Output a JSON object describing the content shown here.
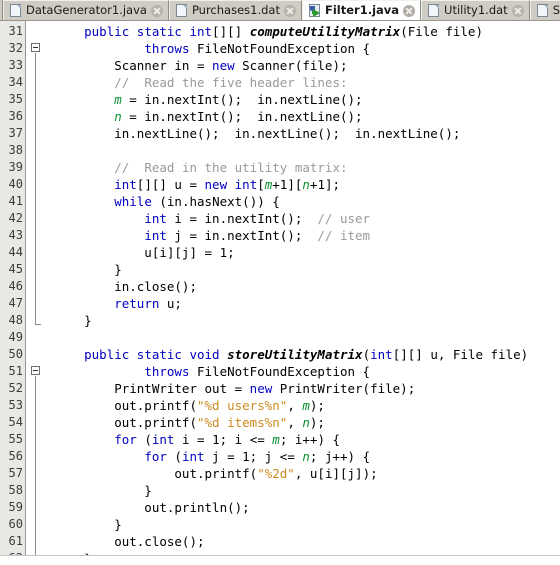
{
  "window": {
    "app": "NetBeans Java Editor",
    "title": "Filter1.java"
  },
  "tabs": [
    {
      "label": "DataGenerator1.java",
      "icon": "java-file-icon",
      "active": false,
      "close": "close-icon"
    },
    {
      "label": "Purchases1.dat",
      "icon": "dat-file-icon",
      "active": false,
      "close": "close-icon"
    },
    {
      "label": "Filter1.java",
      "icon": "java-run-file-icon",
      "active": true,
      "close": "close-icon"
    },
    {
      "label": "Utility1.dat",
      "icon": "dat-file-icon",
      "active": false,
      "close": "close-icon"
    },
    {
      "label": "Similarity",
      "icon": "dat-file-icon",
      "active": false,
      "close": "close-icon"
    }
  ],
  "editor": {
    "first_line": 31,
    "last_line": 62,
    "line_numbers": [
      31,
      32,
      33,
      34,
      35,
      36,
      37,
      38,
      39,
      40,
      41,
      42,
      43,
      44,
      45,
      46,
      47,
      48,
      49,
      50,
      51,
      52,
      53,
      54,
      55,
      56,
      57,
      58,
      59,
      60,
      61,
      62
    ],
    "fold_markers": [
      {
        "line": 32,
        "type": "collapse-box"
      },
      {
        "line": 51,
        "type": "collapse-box"
      }
    ],
    "colors": {
      "keyword": "#0000c0",
      "method": "#000000",
      "comment": "#9a9a9a",
      "field": "#0a8f2e",
      "string": "#cc8b1f",
      "plain": "#000000",
      "gutter_bg": "#e8e8e4",
      "editor_bg": "#ffffff"
    },
    "lines": [
      {
        "n": 31,
        "tokens": [
          {
            "t": "    ",
            "c": "pln"
          },
          {
            "t": "public static int",
            "c": "kw"
          },
          {
            "t": "[][] ",
            "c": "pln"
          },
          {
            "t": "computeUtilityMatrix",
            "c": "mth"
          },
          {
            "t": "(File file)",
            "c": "pln"
          }
        ]
      },
      {
        "n": 32,
        "tokens": [
          {
            "t": "            ",
            "c": "pln"
          },
          {
            "t": "throws",
            "c": "kw"
          },
          {
            "t": " FileNotFoundException {",
            "c": "pln"
          }
        ]
      },
      {
        "n": 33,
        "tokens": [
          {
            "t": "        Scanner in = ",
            "c": "pln"
          },
          {
            "t": "new",
            "c": "kw"
          },
          {
            "t": " Scanner(file);",
            "c": "pln"
          }
        ]
      },
      {
        "n": 34,
        "tokens": [
          {
            "t": "        ",
            "c": "pln"
          },
          {
            "t": "//  Read the five header lines:",
            "c": "cmt"
          }
        ]
      },
      {
        "n": 35,
        "tokens": [
          {
            "t": "        ",
            "c": "pln"
          },
          {
            "t": "m",
            "c": "fld"
          },
          {
            "t": " = in.nextInt();  in.nextLine();",
            "c": "pln"
          }
        ]
      },
      {
        "n": 36,
        "tokens": [
          {
            "t": "        ",
            "c": "pln"
          },
          {
            "t": "n",
            "c": "fld"
          },
          {
            "t": " = in.nextInt();  in.nextLine();",
            "c": "pln"
          }
        ]
      },
      {
        "n": 37,
        "tokens": [
          {
            "t": "        in.nextLine();  in.nextLine();  in.nextLine();",
            "c": "pln"
          }
        ]
      },
      {
        "n": 38,
        "tokens": [
          {
            "t": "",
            "c": "pln"
          }
        ]
      },
      {
        "n": 39,
        "tokens": [
          {
            "t": "        ",
            "c": "pln"
          },
          {
            "t": "//  Read in the utility matrix:",
            "c": "cmt"
          }
        ]
      },
      {
        "n": 40,
        "tokens": [
          {
            "t": "        ",
            "c": "pln"
          },
          {
            "t": "int",
            "c": "kw"
          },
          {
            "t": "[][] u = ",
            "c": "pln"
          },
          {
            "t": "new",
            "c": "kw"
          },
          {
            "t": " ",
            "c": "pln"
          },
          {
            "t": "int",
            "c": "kw"
          },
          {
            "t": "[",
            "c": "pln"
          },
          {
            "t": "m",
            "c": "fld"
          },
          {
            "t": "+1][",
            "c": "pln"
          },
          {
            "t": "n",
            "c": "fld"
          },
          {
            "t": "+1];",
            "c": "pln"
          }
        ]
      },
      {
        "n": 41,
        "tokens": [
          {
            "t": "        ",
            "c": "pln"
          },
          {
            "t": "while",
            "c": "kw"
          },
          {
            "t": " (in.hasNext()) {",
            "c": "pln"
          }
        ]
      },
      {
        "n": 42,
        "tokens": [
          {
            "t": "            ",
            "c": "pln"
          },
          {
            "t": "int",
            "c": "kw"
          },
          {
            "t": " i = in.nextInt();  ",
            "c": "pln"
          },
          {
            "t": "// user",
            "c": "cmt"
          }
        ]
      },
      {
        "n": 43,
        "tokens": [
          {
            "t": "            ",
            "c": "pln"
          },
          {
            "t": "int",
            "c": "kw"
          },
          {
            "t": " j = in.nextInt();  ",
            "c": "pln"
          },
          {
            "t": "// item",
            "c": "cmt"
          }
        ]
      },
      {
        "n": 44,
        "tokens": [
          {
            "t": "            u[i][j] = 1;",
            "c": "pln"
          }
        ]
      },
      {
        "n": 45,
        "tokens": [
          {
            "t": "        }",
            "c": "pln"
          }
        ]
      },
      {
        "n": 46,
        "tokens": [
          {
            "t": "        in.close();",
            "c": "pln"
          }
        ]
      },
      {
        "n": 47,
        "tokens": [
          {
            "t": "        ",
            "c": "pln"
          },
          {
            "t": "return",
            "c": "kw"
          },
          {
            "t": " u;",
            "c": "pln"
          }
        ]
      },
      {
        "n": 48,
        "tokens": [
          {
            "t": "    }",
            "c": "pln"
          }
        ]
      },
      {
        "n": 49,
        "tokens": [
          {
            "t": "",
            "c": "pln"
          }
        ]
      },
      {
        "n": 50,
        "tokens": [
          {
            "t": "    ",
            "c": "pln"
          },
          {
            "t": "public static void",
            "c": "kw"
          },
          {
            "t": " ",
            "c": "pln"
          },
          {
            "t": "storeUtilityMatrix",
            "c": "mth"
          },
          {
            "t": "(",
            "c": "pln"
          },
          {
            "t": "int",
            "c": "kw"
          },
          {
            "t": "[][] u, File file)",
            "c": "pln"
          }
        ]
      },
      {
        "n": 51,
        "tokens": [
          {
            "t": "            ",
            "c": "pln"
          },
          {
            "t": "throws",
            "c": "kw"
          },
          {
            "t": " FileNotFoundException {",
            "c": "pln"
          }
        ]
      },
      {
        "n": 52,
        "tokens": [
          {
            "t": "        PrintWriter out = ",
            "c": "pln"
          },
          {
            "t": "new",
            "c": "kw"
          },
          {
            "t": " PrintWriter(file);",
            "c": "pln"
          }
        ]
      },
      {
        "n": 53,
        "tokens": [
          {
            "t": "        out.printf(",
            "c": "pln"
          },
          {
            "t": "\"%d users%n\"",
            "c": "str"
          },
          {
            "t": ", ",
            "c": "pln"
          },
          {
            "t": "m",
            "c": "fld"
          },
          {
            "t": ");",
            "c": "pln"
          }
        ]
      },
      {
        "n": 54,
        "tokens": [
          {
            "t": "        out.printf(",
            "c": "pln"
          },
          {
            "t": "\"%d items%n\"",
            "c": "str"
          },
          {
            "t": ", ",
            "c": "pln"
          },
          {
            "t": "n",
            "c": "fld"
          },
          {
            "t": ");",
            "c": "pln"
          }
        ]
      },
      {
        "n": 55,
        "tokens": [
          {
            "t": "        ",
            "c": "pln"
          },
          {
            "t": "for",
            "c": "kw"
          },
          {
            "t": " (",
            "c": "pln"
          },
          {
            "t": "int",
            "c": "kw"
          },
          {
            "t": " i = 1; i <= ",
            "c": "pln"
          },
          {
            "t": "m",
            "c": "fld"
          },
          {
            "t": "; i++) {",
            "c": "pln"
          }
        ]
      },
      {
        "n": 56,
        "tokens": [
          {
            "t": "            ",
            "c": "pln"
          },
          {
            "t": "for",
            "c": "kw"
          },
          {
            "t": " (",
            "c": "pln"
          },
          {
            "t": "int",
            "c": "kw"
          },
          {
            "t": " j = 1; j <= ",
            "c": "pln"
          },
          {
            "t": "n",
            "c": "fld"
          },
          {
            "t": "; j++) {",
            "c": "pln"
          }
        ]
      },
      {
        "n": 57,
        "tokens": [
          {
            "t": "                out.printf(",
            "c": "pln"
          },
          {
            "t": "\"%2d\"",
            "c": "str"
          },
          {
            "t": ", u[i][j]);",
            "c": "pln"
          }
        ]
      },
      {
        "n": 58,
        "tokens": [
          {
            "t": "            }",
            "c": "pln"
          }
        ]
      },
      {
        "n": 59,
        "tokens": [
          {
            "t": "            out.println();",
            "c": "pln"
          }
        ]
      },
      {
        "n": 60,
        "tokens": [
          {
            "t": "        }",
            "c": "pln"
          }
        ]
      },
      {
        "n": 61,
        "tokens": [
          {
            "t": "        out.close();",
            "c": "pln"
          }
        ]
      },
      {
        "n": 62,
        "tokens": [
          {
            "t": "    }",
            "c": "pln"
          }
        ]
      }
    ]
  }
}
